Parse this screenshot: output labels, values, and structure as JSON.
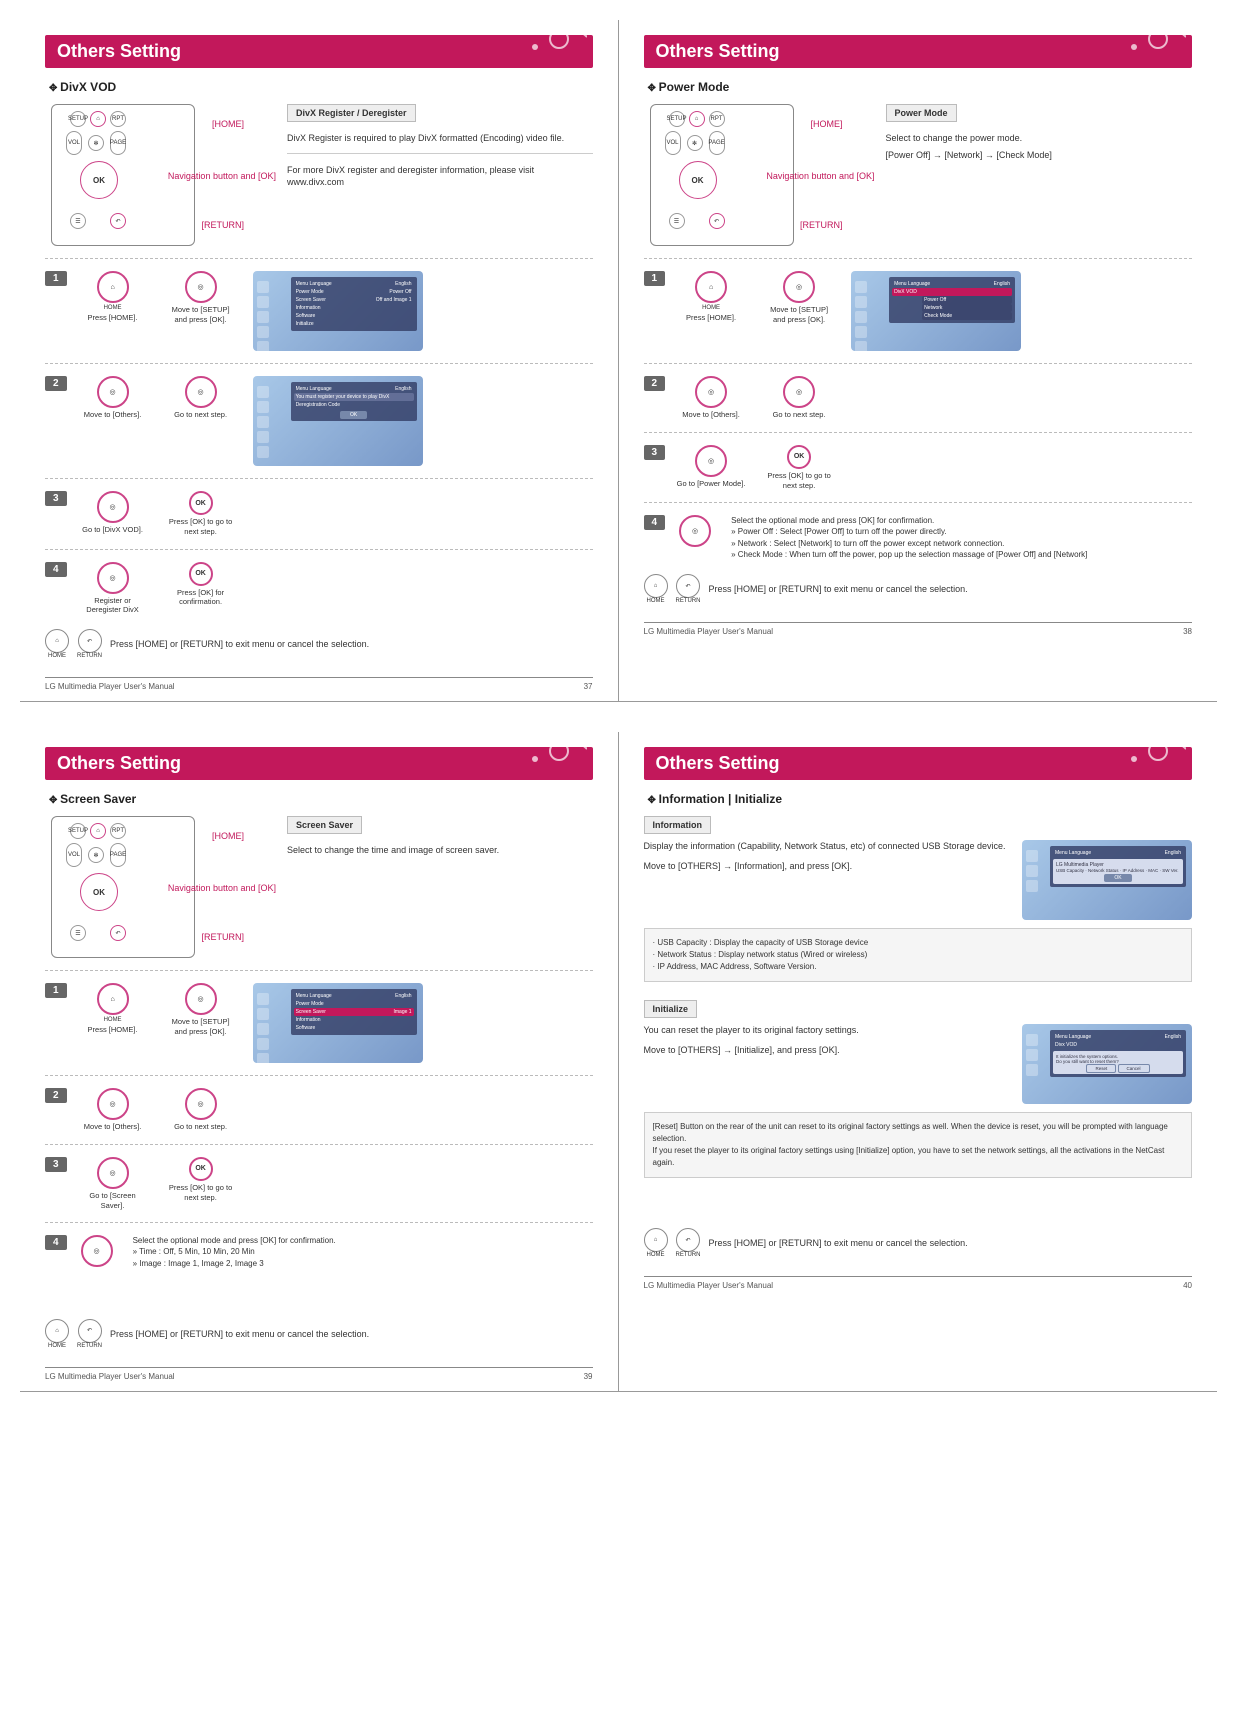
{
  "common": {
    "section_title": "Others Setting",
    "exit_text": "Press [HOME] or [RETURN] to exit menu or cancel the selection.",
    "footer_title": "LG Multimedia Player User's Manual",
    "home_label": "HOME",
    "return_label": "RETURN",
    "callout_home": "[HOME]",
    "callout_nav": "Navigation button and [OK]",
    "callout_return": "[RETURN]"
  },
  "p37": {
    "page_no": "37",
    "subheading": "DivX VOD",
    "info_title": "DivX Register / Deregister",
    "info_text1": "DivX Register is required to play DivX formatted (Encoding) video file.",
    "info_text2": "For more DivX register and deregister information, please visit  www.divx.com",
    "steps": {
      "s1a": "Press [HOME].",
      "s1b": "Move to [SETUP] and press [OK].",
      "s2a": "Move to [Others].",
      "s2b": "Go to next step.",
      "s3a": "Go to [DivX VOD].",
      "s3b": "Press [OK] to go  to next step.",
      "s4a": "Register or Deregister DivX",
      "s4b": "Press [OK] for confirmation."
    }
  },
  "p38": {
    "page_no": "38",
    "subheading": "Power Mode",
    "info_title": "Power Mode",
    "info_text1": "Select to change the power mode.",
    "info_text2": "[Power Off] → [Network] → [Check Mode]",
    "steps": {
      "s1a": "Press [HOME].",
      "s1b": "Move to [SETUP] and press [OK].",
      "s2a": "Move to [Others].",
      "s2b": "Go to next step.",
      "s3a": "Go to [Power Mode].",
      "s3b": "Press [OK] to go to next step.",
      "s4_text": "Select the optional mode and press [OK] for confirmation.\n» Power Off : Select [Power Off] to turn off the power directly.\n» Network : Select [Network] to turn off the power except network connection.\n» Check Mode : When turn off the power, pop up the selection massage of [Power Off] and [Network]"
    }
  },
  "p39": {
    "page_no": "39",
    "subheading": "Screen Saver",
    "info_title": "Screen Saver",
    "info_text1": "Select to change the time and image of screen saver.",
    "steps": {
      "s1a": "Press [HOME].",
      "s1b": "Move to [SETUP] and press [OK].",
      "s2a": "Move to [Others].",
      "s2b": "Go to next step.",
      "s3a": "Go to [Screen Saver].",
      "s3b": "Press [OK] to go  to next step.",
      "s4_text": "Select the optional mode and press [OK] for confirmation.\n» Time : Off, 5 Min, 10 Min, 20 Min\n» Image : Image 1, Image 2, Image 3"
    }
  },
  "p40": {
    "page_no": "40",
    "subheading": "Information | Initialize",
    "info": {
      "title": "Information",
      "text1": "Display the information (Capability, Network Status, etc) of connected USB Storage device.",
      "text2": "Move to [OTHERS] → [Information], and press [OK].",
      "bullets": {
        "b1": "USB Capacity : Display the capacity of USB Storage device",
        "b2": "Network Status : Display network status (Wired or wireless)",
        "b3": "IP Address, MAC Address, Software Version."
      }
    },
    "init": {
      "title": "Initialize",
      "text1": "You can reset the player to its original factory settings.",
      "text2": "Move to [OTHERS] → [Initialize], and press [OK].",
      "note": "[Reset] Button on the rear of the unit can reset to its original factory settings as well. When the device is reset, you will be prompted with language selection.\nIf you reset the player to its original factory settings using [Initialize] option, you have to set the network settings, all the activations in the NetCast again."
    }
  }
}
